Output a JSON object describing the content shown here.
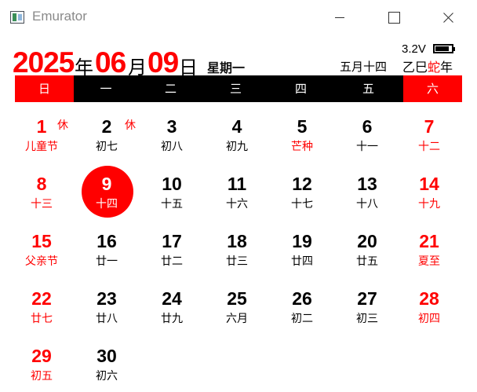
{
  "window": {
    "title": "Emurator",
    "icon": "app-icon",
    "controls": [
      "minimize-icon",
      "maximize-icon",
      "close-icon"
    ]
  },
  "header": {
    "year": "2025",
    "year_unit": "年",
    "month": "06",
    "month_unit": "月",
    "day": "09",
    "day_unit": "日",
    "weekday": "星期一",
    "lunar_date": "五月十四",
    "voltage": "3.2V",
    "battery_icon": "battery-icon",
    "ganzhi": "乙巳",
    "zodiac": "蛇",
    "year_suffix": "年"
  },
  "weekdays": [
    "日",
    "一",
    "二",
    "三",
    "四",
    "五",
    "六"
  ],
  "colors": {
    "accent": "#ff0000",
    "bar": "#000000",
    "text": "#000000"
  },
  "days": [
    {
      "solar": "1",
      "lunar": "儿童节",
      "holiday": "休"
    },
    {
      "solar": "2",
      "lunar": "初七",
      "holiday": "休"
    },
    {
      "solar": "3",
      "lunar": "初八"
    },
    {
      "solar": "4",
      "lunar": "初九"
    },
    {
      "solar": "5",
      "lunar": "芒种"
    },
    {
      "solar": "6",
      "lunar": "十一"
    },
    {
      "solar": "7",
      "lunar": "十二"
    },
    {
      "solar": "8",
      "lunar": "十三"
    },
    {
      "solar": "9",
      "lunar": "十四"
    },
    {
      "solar": "10",
      "lunar": "十五"
    },
    {
      "solar": "11",
      "lunar": "十六"
    },
    {
      "solar": "12",
      "lunar": "十七"
    },
    {
      "solar": "13",
      "lunar": "十八"
    },
    {
      "solar": "14",
      "lunar": "十九"
    },
    {
      "solar": "15",
      "lunar": "父亲节"
    },
    {
      "solar": "16",
      "lunar": "廿一"
    },
    {
      "solar": "17",
      "lunar": "廿二"
    },
    {
      "solar": "18",
      "lunar": "廿三"
    },
    {
      "solar": "19",
      "lunar": "廿四"
    },
    {
      "solar": "20",
      "lunar": "廿五"
    },
    {
      "solar": "21",
      "lunar": "夏至"
    },
    {
      "solar": "22",
      "lunar": "廿七"
    },
    {
      "solar": "23",
      "lunar": "廿八"
    },
    {
      "solar": "24",
      "lunar": "廿九"
    },
    {
      "solar": "25",
      "lunar": "六月"
    },
    {
      "solar": "26",
      "lunar": "初二"
    },
    {
      "solar": "27",
      "lunar": "初三"
    },
    {
      "solar": "28",
      "lunar": "初四"
    },
    {
      "solar": "29",
      "lunar": "初五"
    },
    {
      "solar": "30",
      "lunar": "初六"
    }
  ]
}
